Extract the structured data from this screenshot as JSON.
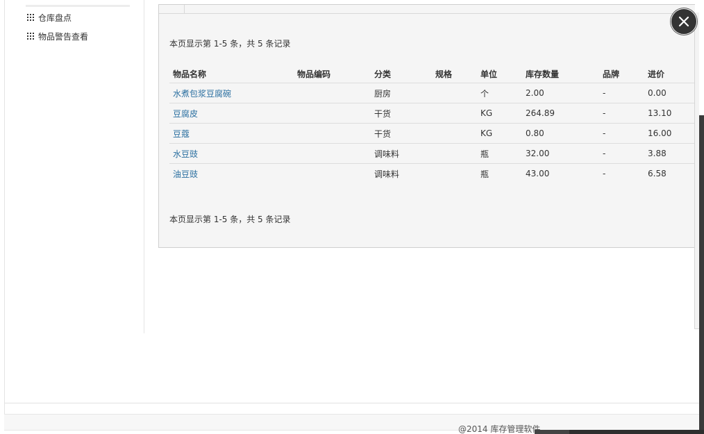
{
  "sidebar": {
    "items": [
      {
        "label": "仓库盘点",
        "icon": "grid-icon"
      },
      {
        "label": "物品警告查看",
        "icon": "grid-icon"
      }
    ]
  },
  "modal": {
    "summary_top": "本页显示第 1-5 条，共 5 条记录",
    "summary_bottom": "本页显示第 1-5 条，共 5 条记录",
    "columns": [
      "物品名称",
      "物品编码",
      "分类",
      "规格",
      "单位",
      "库存数量",
      "品牌",
      "进价"
    ],
    "rows": [
      {
        "name": "水煮包浆豆腐碗",
        "code": "",
        "category": "厨房",
        "spec": "",
        "unit": "个",
        "stock": "2.00",
        "brand": "-",
        "price": "0.00"
      },
      {
        "name": "豆腐皮",
        "code": "",
        "category": "干货",
        "spec": "",
        "unit": "KG",
        "stock": "264.89",
        "brand": "-",
        "price": "13.10"
      },
      {
        "name": "豆蔻",
        "code": "",
        "category": "干货",
        "spec": "",
        "unit": "KG",
        "stock": "0.80",
        "brand": "-",
        "price": "16.00"
      },
      {
        "name": "水豆豉",
        "code": "",
        "category": "调味料",
        "spec": "",
        "unit": "瓶",
        "stock": "32.00",
        "brand": "-",
        "price": "3.88"
      },
      {
        "name": "油豆豉",
        "code": "",
        "category": "调味料",
        "spec": "",
        "unit": "瓶",
        "stock": "43.00",
        "brand": "-",
        "price": "6.58"
      }
    ],
    "close_icon": "close-icon"
  },
  "footer": {
    "copyright": "@2014 库存管理软件"
  },
  "colors": {
    "link": "#2a6fa0",
    "close_button": "#333333",
    "modal_bg": "#f5f5f5"
  }
}
